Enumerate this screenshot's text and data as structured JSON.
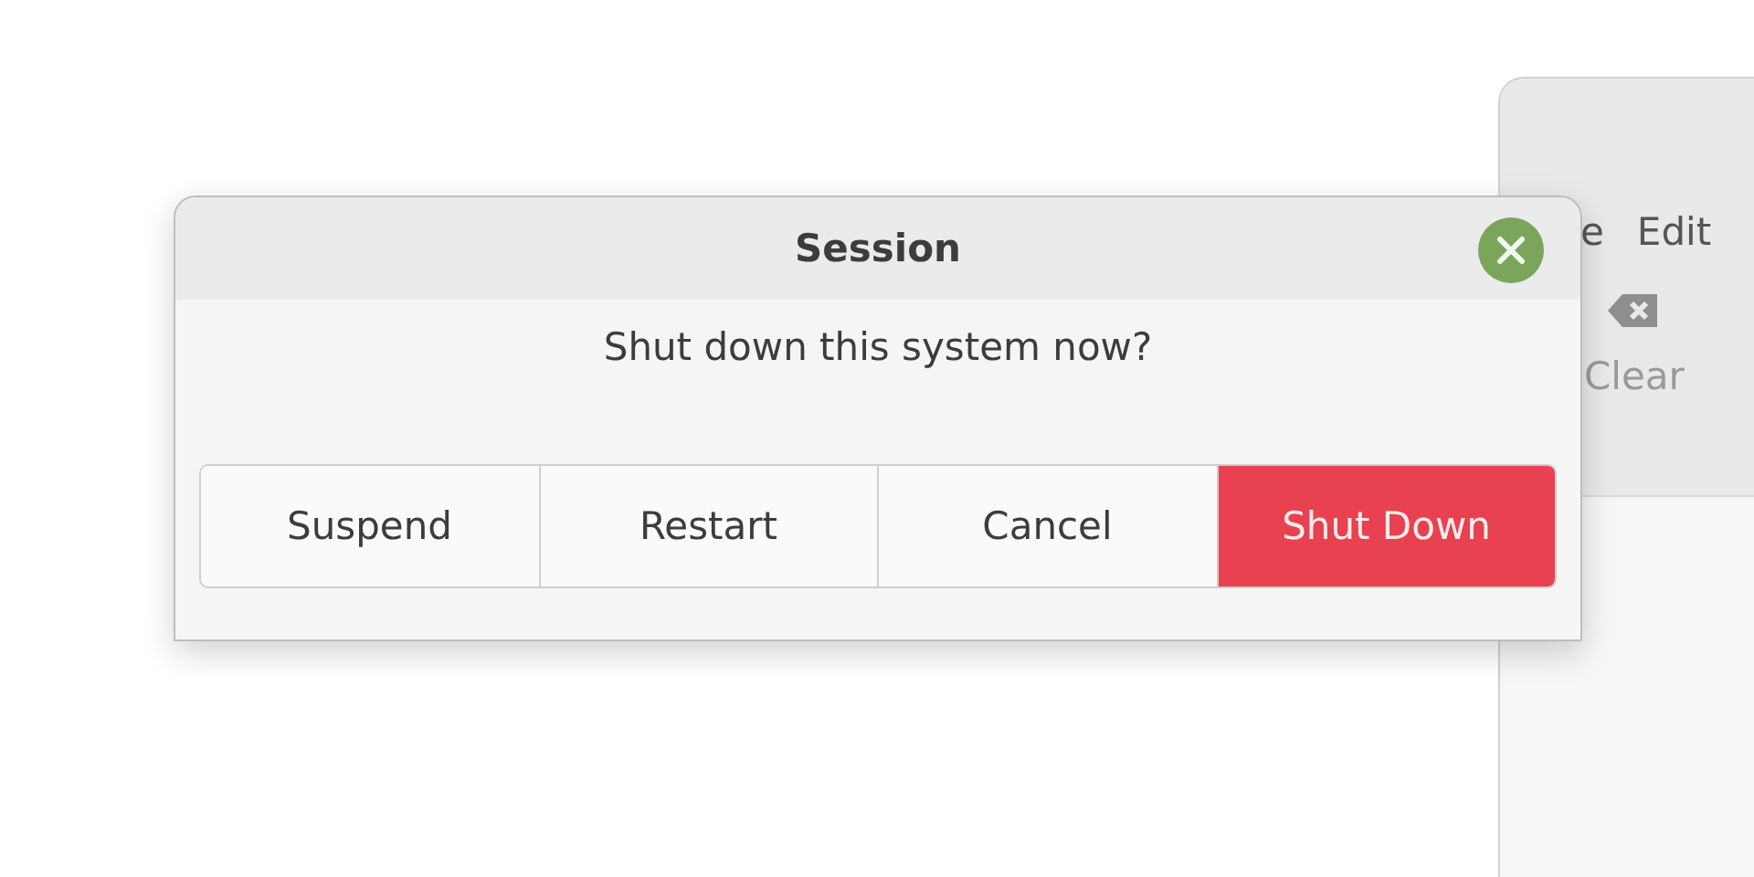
{
  "background_window": {
    "menu": [
      "e",
      "Edit"
    ],
    "toolbar": [
      {
        "label": "Clear"
      }
    ]
  },
  "dialog": {
    "title": "Session",
    "message": "Shut down this system now?",
    "buttons": [
      {
        "label": "Suspend",
        "kind": "normal"
      },
      {
        "label": "Restart",
        "kind": "normal"
      },
      {
        "label": "Cancel",
        "kind": "normal"
      },
      {
        "label": "Shut Down",
        "kind": "destructive"
      }
    ]
  }
}
